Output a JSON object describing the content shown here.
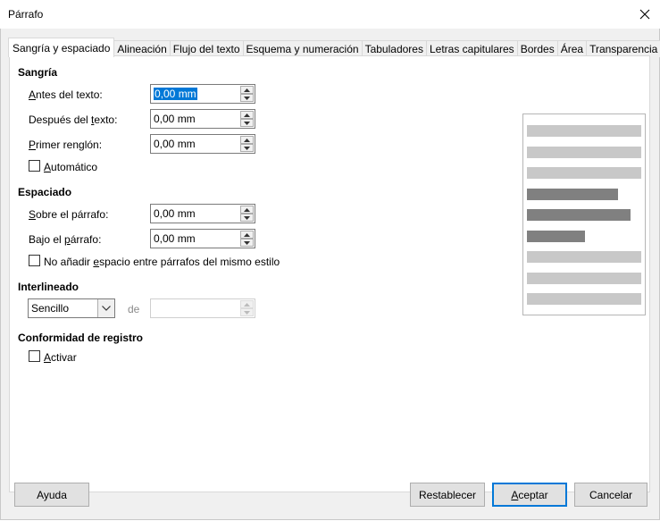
{
  "window": {
    "title": "Párrafo",
    "close_label": "✕"
  },
  "tabs": [
    {
      "label": "Sangría y espaciado",
      "active": true
    },
    {
      "label": "Alineación"
    },
    {
      "label": "Flujo del texto"
    },
    {
      "label": "Esquema y numeración"
    },
    {
      "label": "Tabuladores"
    },
    {
      "label": "Letras capitulares"
    },
    {
      "label": "Bordes"
    },
    {
      "label": "Área"
    },
    {
      "label": "Transparencia"
    }
  ],
  "indent": {
    "heading": "Sangría",
    "before_text": {
      "label_a": "A",
      "label_b": "ntes del texto:",
      "value": "0,00 mm"
    },
    "after_text": {
      "label_a": "Después del ",
      "label_b": "t",
      "label_c": "exto:",
      "value": "0,00 mm"
    },
    "first_line": {
      "label_a": "P",
      "label_b": "rimer renglón:",
      "value": "0,00 mm"
    },
    "automatic": {
      "label_a": "A",
      "label_b": "utomático",
      "checked": false
    }
  },
  "spacing": {
    "heading": "Espaciado",
    "above": {
      "label_a": "S",
      "label_b": "obre el párrafo:",
      "value": "0,00 mm"
    },
    "below": {
      "label_a": "Bajo el ",
      "label_b": "p",
      "label_c": "árrafo:",
      "value": "0,00 mm"
    },
    "no_space": {
      "label_a": "No añadir ",
      "label_b": "e",
      "label_c": "spacio entre párrafos del mismo estilo",
      "checked": false
    }
  },
  "line_spacing": {
    "heading": "Interlineado",
    "mode": "Sencillo",
    "of_label": "de",
    "value": ""
  },
  "register": {
    "heading": "Conformidad de registro",
    "activate": {
      "label_a": "A",
      "label_b": "ctivar",
      "checked": false
    }
  },
  "preview": {
    "light_color": "#c8c8c8",
    "dark_color": "#808080",
    "bars": [
      {
        "shade": "light",
        "length": 1.0
      },
      {
        "shade": "light",
        "length": 1.0
      },
      {
        "shade": "light",
        "length": 1.0
      },
      {
        "shade": "dark",
        "length": 0.8
      },
      {
        "shade": "dark",
        "length": 0.91
      },
      {
        "shade": "dark",
        "length": 0.51
      },
      {
        "shade": "light",
        "length": 1.0
      },
      {
        "shade": "light",
        "length": 1.0
      },
      {
        "shade": "light",
        "length": 1.0
      }
    ]
  },
  "buttons": {
    "help": "Ayuda",
    "reset": "Restablecer",
    "ok_a": "A",
    "ok_b": "ceptar",
    "cancel": "Cancelar"
  },
  "colors": {
    "accent": "#0078d7"
  }
}
